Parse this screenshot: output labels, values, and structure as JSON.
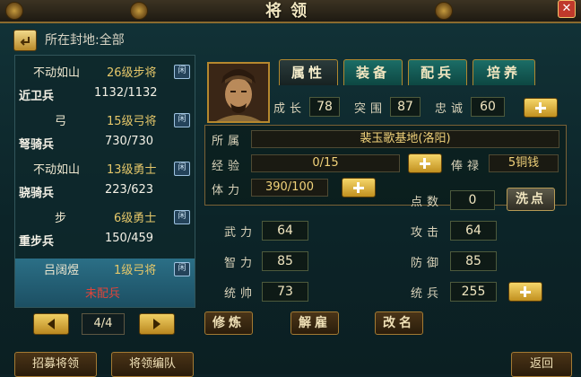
{
  "window": {
    "title": "将领"
  },
  "location": {
    "label": "所在封地:全部"
  },
  "generals": [
    {
      "name": "不动如山",
      "level": "26级步将",
      "badge": "闲",
      "soldier_type": "近卫兵",
      "soldiers": "1132/1132"
    },
    {
      "name": "弓",
      "level": "15级弓将",
      "badge": "闲",
      "soldier_type": "弩骑兵",
      "soldiers": "730/730"
    },
    {
      "name": "不动如山",
      "level": "13级勇士",
      "badge": "闲",
      "soldier_type": "骁骑兵",
      "soldiers": "223/623"
    },
    {
      "name": "步",
      "level": "6级勇士",
      "badge": "闲",
      "soldier_type": "重步兵",
      "soldiers": "150/459"
    },
    {
      "name": "吕阔煜",
      "level": "1级弓将",
      "badge": "闲",
      "soldier_type": "",
      "soldiers": "未配兵"
    }
  ],
  "pager": {
    "page": "4/4"
  },
  "tabs": [
    "属性",
    "装备",
    "配兵",
    "培养"
  ],
  "growth": {
    "chengzhang_label": "成长",
    "chengzhang": "78",
    "tuwei_label": "突围",
    "tuwei": "87",
    "zhongcheng_label": "忠诚",
    "zhongcheng": "60"
  },
  "info": {
    "fief_label": "所属",
    "fief": "裴玉歌基地(洛阳)",
    "exp_label": "经验",
    "exp": "0/15",
    "salary_label": "俸禄",
    "salary": "5铜钱",
    "stamina_label": "体力",
    "stamina": "390/100",
    "points_label": "点数",
    "points": "0",
    "reset_label": "洗点"
  },
  "attributes": {
    "wuli_label": "武力",
    "wuli": "64",
    "zhili_label": "智力",
    "zhili": "85",
    "tongshuai_label": "统帅",
    "tongshuai": "73",
    "gongji_label": "攻击",
    "gongji": "64",
    "fangyu_label": "防御",
    "fangyu": "85",
    "tongbing_label": "统兵",
    "tongbing": "255"
  },
  "actions": {
    "train": "修炼",
    "dismiss": "解雇",
    "rename": "改名"
  },
  "bottom": {
    "recruit": "招募将领",
    "formation": "将领编队",
    "back": "返回"
  }
}
